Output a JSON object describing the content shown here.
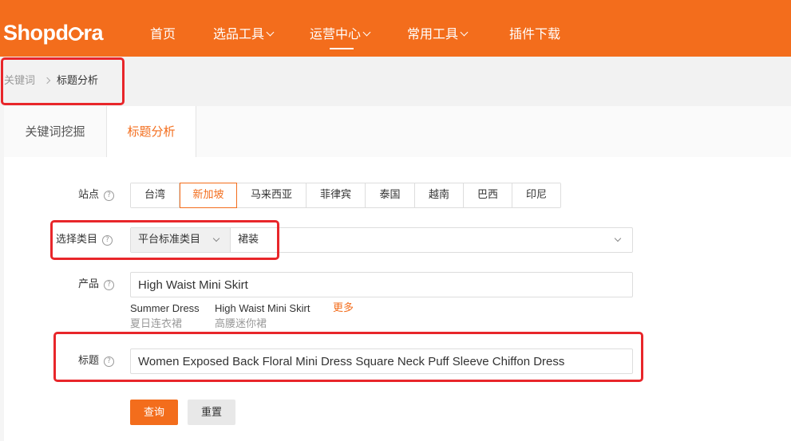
{
  "brand": {
    "logo_prefix": "Shopd",
    "logo_suffix": "ra",
    "color": "#f36d1c"
  },
  "nav": {
    "items": [
      {
        "label": "首页"
      },
      {
        "label": "选品工具"
      },
      {
        "label": "运营中心"
      },
      {
        "label": "常用工具"
      },
      {
        "label": "插件下载"
      }
    ]
  },
  "breadcrumb": {
    "parent": "关键词",
    "current": "标题分析"
  },
  "tabs": [
    {
      "label": "关键词挖掘"
    },
    {
      "label": "标题分析"
    }
  ],
  "form": {
    "site": {
      "label": "站点",
      "options": [
        "台湾",
        "新加坡",
        "马来西亚",
        "菲律宾",
        "泰国",
        "越南",
        "巴西",
        "印尼"
      ],
      "selected": "新加坡"
    },
    "category": {
      "label": "选择类目",
      "type": "平台标准类目",
      "value": "裙装"
    },
    "product": {
      "label": "产品",
      "value": "High Waist Mini Skirt",
      "suggestions": [
        {
          "en": "Summer Dress",
          "cn": "夏日连衣裙"
        },
        {
          "en": "High Waist Mini Skirt",
          "cn": "高腰迷你裙"
        }
      ],
      "more": "更多"
    },
    "title": {
      "label": "标题",
      "value": "Women Exposed Back Floral Mini Dress Square Neck Puff Sleeve Chiffon Dress"
    },
    "help_glyph": "?",
    "submit": "查询",
    "reset": "重置"
  }
}
